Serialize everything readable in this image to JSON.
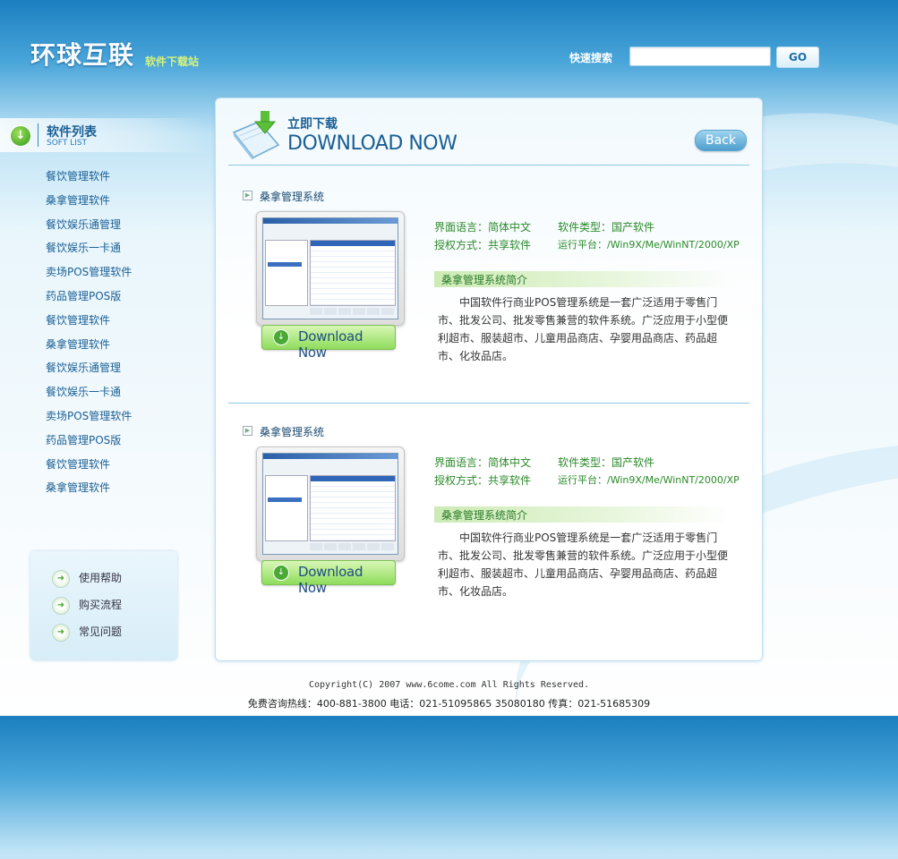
{
  "header": {
    "logo": "环球互联",
    "logo_sub": "软件下载站",
    "search_label": "快速搜索",
    "search_value": "",
    "go_label": "GO"
  },
  "sidebar": {
    "title": "软件列表",
    "title_en": "SOFT LIST",
    "items": [
      "餐饮管理软件",
      "桑拿管理软件",
      "餐饮娱乐通管理",
      "餐饮娱乐一卡通",
      "卖场POS管理软件",
      "药品管理POS版",
      "餐饮管理软件",
      "桑拿管理软件",
      "餐饮娱乐通管理",
      "餐饮娱乐一卡通",
      "卖场POS管理软件",
      "药品管理POS版",
      "餐饮管理软件",
      "桑拿管理软件"
    ],
    "help": [
      "使用帮助",
      "购买流程",
      "常见问题"
    ]
  },
  "main": {
    "title_cn": "立即下载",
    "title_en": "DOWNLOAD NOW",
    "back_label": "Back",
    "items": [
      {
        "name": "桑拿管理系统",
        "lang": "界面语言：简体中文",
        "type": "软件类型：国产软件",
        "license": "授权方式：共享软件",
        "platform": "运行平台：/Win9X/Me/WinNT/2000/XP",
        "intro_label": "桑拿管理系统简介",
        "intro_text": "中国软件行商业POS管理系统是一套广泛适用于零售门市、批发公司、批发零售兼营的软件系统。广泛应用于小型便利超市、服装超市、儿童用品商店、孕婴用品商店、药品超市、化妆品店。",
        "download_label": "Download Now"
      },
      {
        "name": "桑拿管理系统",
        "lang": "界面语言：简体中文",
        "type": "软件类型：国产软件",
        "license": "授权方式：共享软件",
        "platform": "运行平台：/Win9X/Me/WinNT/2000/XP",
        "intro_label": "桑拿管理系统简介",
        "intro_text": "中国软件行商业POS管理系统是一套广泛适用于零售门市、批发公司、批发零售兼营的软件系统。广泛应用于小型便利超市、服装超市、儿童用品商店、孕婴用品商店、药品超市、化妆品店。",
        "download_label": "Download Now"
      }
    ]
  },
  "footer": {
    "copyright": "Copyright(C) 2007 www.6come.com All Rights Reserved.",
    "contact": "免费咨询热线：400-881-3800  电话：021-51095865 35080180  传真：021-51685309"
  }
}
